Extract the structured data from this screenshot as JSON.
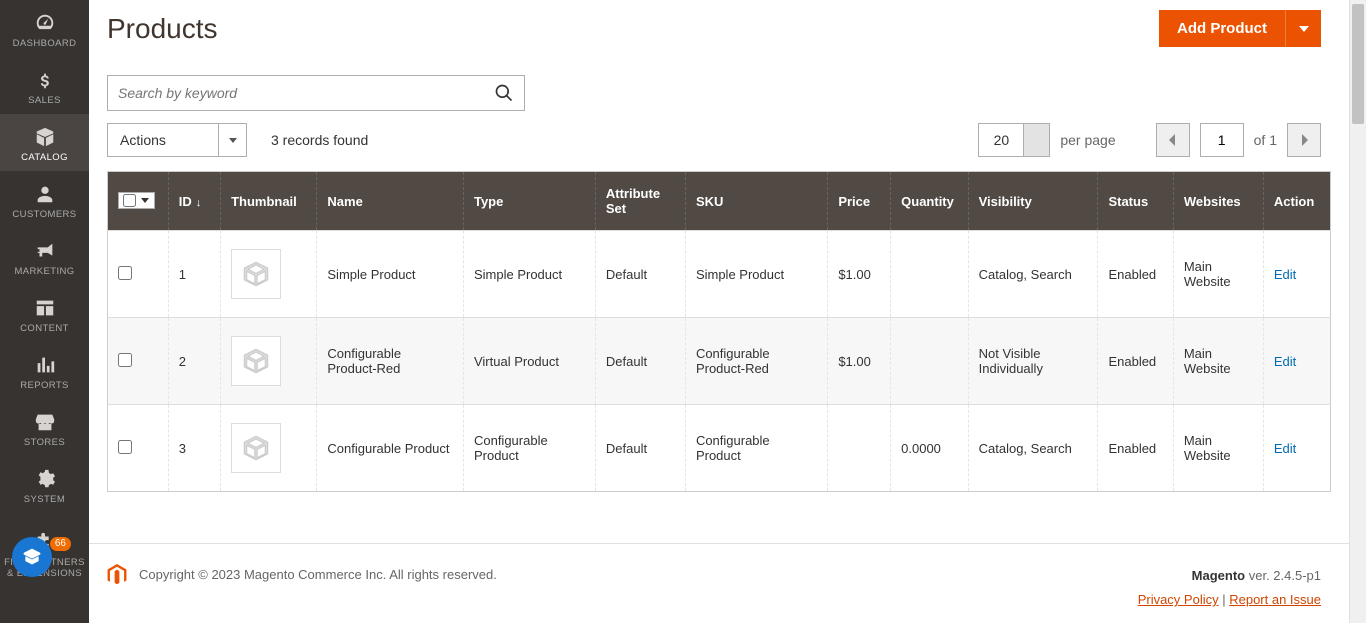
{
  "sidebar": {
    "items": [
      {
        "label": "DASHBOARD",
        "name": "nav-dashboard"
      },
      {
        "label": "SALES",
        "name": "nav-sales"
      },
      {
        "label": "CATALOG",
        "name": "nav-catalog",
        "active": true
      },
      {
        "label": "CUSTOMERS",
        "name": "nav-customers"
      },
      {
        "label": "MARKETING",
        "name": "nav-marketing"
      },
      {
        "label": "CONTENT",
        "name": "nav-content"
      },
      {
        "label": "REPORTS",
        "name": "nav-reports"
      },
      {
        "label": "STORES",
        "name": "nav-stores"
      },
      {
        "label": "SYSTEM",
        "name": "nav-system"
      },
      {
        "label": "FIND PARTNERS & EXTENSIONS",
        "name": "nav-partners"
      }
    ],
    "badge": "66"
  },
  "page": {
    "title": "Products",
    "add_button": "Add Product"
  },
  "search": {
    "placeholder": "Search by keyword"
  },
  "toolbar": {
    "actions_label": "Actions",
    "records_found": "3 records found",
    "per_page_value": "20",
    "per_page_label": "per page",
    "page_value": "1",
    "of_label": "of 1"
  },
  "columns": {
    "id": "ID",
    "thumbnail": "Thumbnail",
    "name": "Name",
    "type": "Type",
    "attribute_set": "Attribute Set",
    "sku": "SKU",
    "price": "Price",
    "quantity": "Quantity",
    "visibility": "Visibility",
    "status": "Status",
    "websites": "Websites",
    "action": "Action"
  },
  "rows": [
    {
      "id": "1",
      "name": "Simple Product",
      "type": "Simple Product",
      "attribute_set": "Default",
      "sku": "Simple Product",
      "price": "$1.00",
      "quantity": "",
      "visibility": "Catalog, Search",
      "status": "Enabled",
      "websites": "Main Website",
      "action": "Edit"
    },
    {
      "id": "2",
      "name": "Configurable Product-Red",
      "type": "Virtual Product",
      "attribute_set": "Default",
      "sku": "Configurable Product-Red",
      "price": "$1.00",
      "quantity": "",
      "visibility": "Not Visible Individually",
      "status": "Enabled",
      "websites": "Main Website",
      "action": "Edit"
    },
    {
      "id": "3",
      "name": "Configurable Product",
      "type": "Configurable Product",
      "attribute_set": "Default",
      "sku": "Configurable Product",
      "price": "",
      "quantity": "0.0000",
      "visibility": "Catalog, Search",
      "status": "Enabled",
      "websites": "Main Website",
      "action": "Edit"
    }
  ],
  "footer": {
    "copyright": "Copyright © 2023 Magento Commerce Inc. All rights reserved.",
    "brand": "Magento",
    "version": " ver. 2.4.5-p1",
    "privacy": "Privacy Policy",
    "sep": " | ",
    "report": "Report an Issue"
  }
}
